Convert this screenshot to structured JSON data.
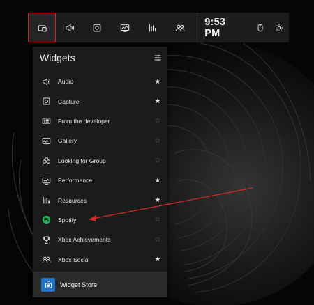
{
  "topbar": {
    "clock": "9:53 PM",
    "buttons": [
      "widget-menu-icon",
      "audio-icon",
      "capture-icon",
      "performance-icon",
      "resources-icon",
      "social-icon"
    ]
  },
  "panel": {
    "title": "Widgets",
    "items": [
      {
        "label": "Audio",
        "icon": "audio-icon",
        "favorite": true
      },
      {
        "label": "Capture",
        "icon": "capture-icon",
        "favorite": true
      },
      {
        "label": "From the developer",
        "icon": "developer-icon",
        "favorite": false
      },
      {
        "label": "Gallery",
        "icon": "gallery-icon",
        "favorite": false
      },
      {
        "label": "Looking for Group",
        "icon": "binoculars-icon",
        "favorite": false
      },
      {
        "label": "Performance",
        "icon": "performance-icon",
        "favorite": true
      },
      {
        "label": "Resources",
        "icon": "resources-icon",
        "favorite": true
      },
      {
        "label": "Spotify",
        "icon": "spotify-icon",
        "favorite": false
      },
      {
        "label": "Xbox Achievements",
        "icon": "trophy-icon",
        "favorite": false
      },
      {
        "label": "Xbox Social",
        "icon": "social-icon",
        "favorite": true
      }
    ],
    "store_label": "Widget Store"
  },
  "stars": {
    "on": "★",
    "off": "☆"
  },
  "colors": {
    "highlight": "#e02020",
    "accent": "#1e73c8",
    "spotify": "#1db954",
    "arrow": "#d42a2a"
  }
}
